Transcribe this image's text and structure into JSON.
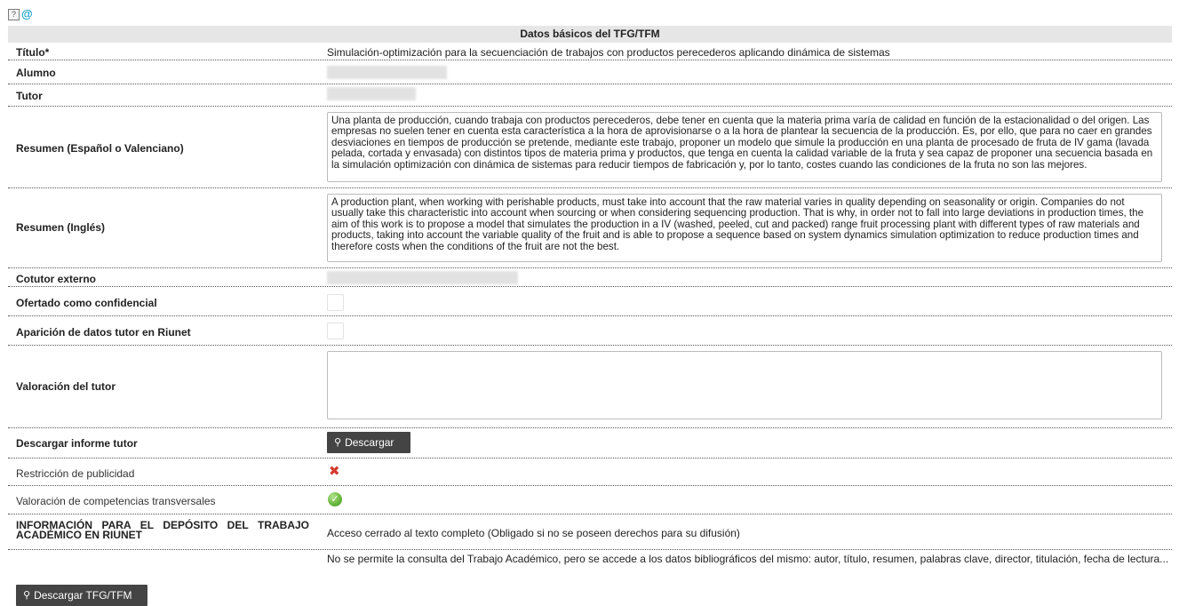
{
  "header": {
    "title": "Datos básicos del TFG/TFM"
  },
  "icons": {
    "help": "?",
    "at": "@"
  },
  "fields": {
    "titulo_label": "Título*",
    "titulo_value": "Simulación-optimización para la secuenciación de trabajos con productos perecederos aplicando dinámica de sistemas",
    "alumno_label": "Alumno",
    "tutor_label": "Tutor",
    "resumen_es_label": "Resumen (Español o Valenciano)",
    "resumen_es_value": "Una planta de producción, cuando trabaja con productos perecederos, debe tener en cuenta que la materia prima varía de calidad en función de la estacionalidad o del origen. Las empresas no suelen tener en cuenta esta característica a la hora de aprovisionarse o a la hora de plantear la secuencia de la producción. Es, por ello, que para no caer en grandes desviaciones en tiempos de producción se pretende, mediante este trabajo, proponer un modelo que simule la producción en una planta de procesado de fruta de IV gama (lavada pelada, cortada y envasada) con distintos tipos de materia prima y productos, que tenga en cuenta la calidad variable de la fruta y sea capaz de proponer una secuencia basada en la simulación optimización con dinámica de sistemas para reducir tiempos de fabricación y, por lo tanto, costes cuando las condiciones de la fruta no son las mejores.",
    "resumen_en_label": "Resumen (Inglés)",
    "resumen_en_value": "A production plant, when working with perishable products, must take into account that the raw material varies in quality depending on seasonality or origin. Companies do not usually take this characteristic into account when sourcing or when considering sequencing production. That is why, in order not to fall into large deviations in production times, the aim of this work is to propose a model that simulates the production in a IV (washed, peeled, cut and packed) range fruit processing plant with different types of raw materials and products, taking into account the variable quality of the fruit and is able to propose a sequence based on system dynamics simulation optimization to reduce production times and therefore costs when the conditions of the fruit are not the best.",
    "cotutor_label": "Cotutor externo",
    "confidencial_label": "Ofertado como confidencial",
    "riunet_label": "Aparición de datos tutor en Riunet",
    "valoracion_label": "Valoración del tutor",
    "descargar_informe_label": "Descargar informe tutor",
    "descargar_button": "Descargar",
    "restriccion_label": "Restricción de publicidad",
    "competencias_label": "Valoración de competencias transversales",
    "info_label": "INFORMACIÓN PARA EL DEPÓSITO DEL TRABAJO ACADÉMICO EN RIUNET",
    "acceso_value": "Acceso cerrado al texto completo (Obligado si no se poseen derechos para su difusión)",
    "consulta_value": "No se permite la consulta del Trabajo Académico, pero se accede a los datos bibliográficos del mismo: autor, título, resumen, palabras clave, director, titulación, fecha de lectura..."
  },
  "footer": {
    "download_button": "Descargar TFG/TFM"
  }
}
